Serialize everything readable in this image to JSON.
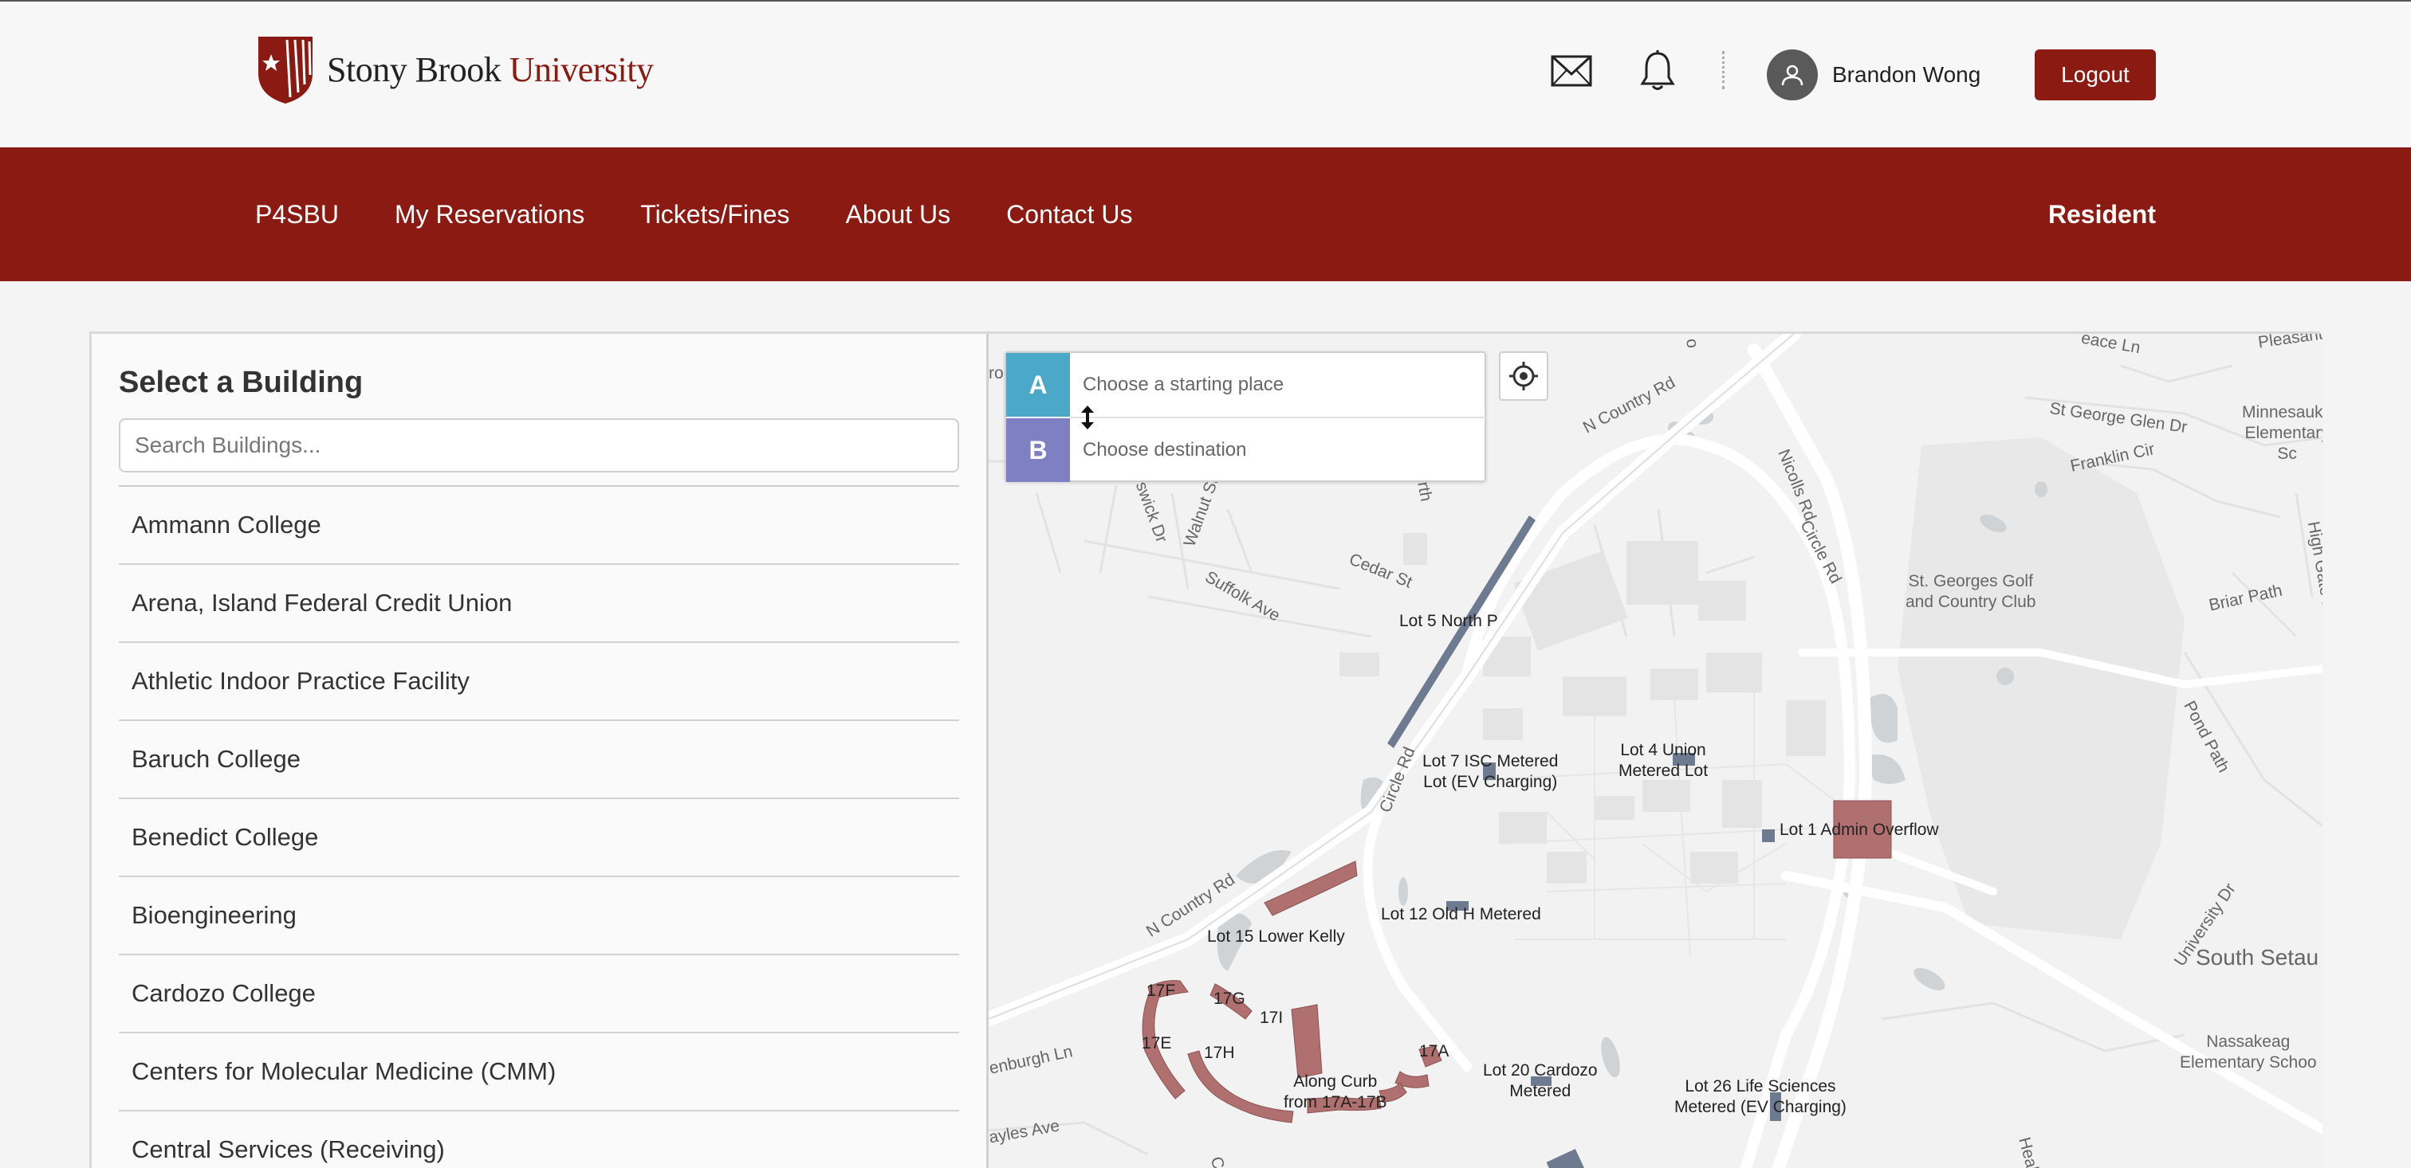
{
  "header": {
    "logo_word1": "Stony Brook",
    "logo_word2": "University",
    "mail_icon": "envelope-icon",
    "notifications_icon": "bell-icon",
    "user_name": "Brandon Wong",
    "logout_label": "Logout"
  },
  "nav": {
    "items": [
      {
        "label": "P4SBU"
      },
      {
        "label": "My Reservations"
      },
      {
        "label": "Tickets/Fines"
      },
      {
        "label": "About Us"
      },
      {
        "label": "Contact Us"
      }
    ],
    "role": "Resident"
  },
  "buildings": {
    "title": "Select a Building",
    "search_placeholder": "Search Buildings...",
    "items": [
      "Ammann College",
      "Arena, Island Federal Credit Union",
      "Athletic Indoor Practice Facility",
      "Baruch College",
      "Benedict College",
      "Bioengineering",
      "Cardozo College",
      "Centers for Molecular Medicine (CMM)",
      "Central Services (Receiving)"
    ]
  },
  "map": {
    "route": {
      "a_label": "A",
      "b_label": "B",
      "start_placeholder": "Choose a starting place",
      "destination_placeholder": "Choose destination"
    },
    "lots": {
      "lot5": "Lot 5 North P",
      "lot7_line1": "Lot 7 ISC Metered",
      "lot7_line2": "Lot (EV Charging)",
      "lot4_line1": "Lot 4 Union",
      "lot4_line2": "Metered Lot",
      "lot1": "Lot 1 Admin Overflow",
      "lot12": "Lot 12 Old H Metered",
      "lot15": "Lot 15 Lower Kelly",
      "l17f": "17F",
      "l17g": "17G",
      "l17i": "17I",
      "l17e": "17E",
      "l17h": "17H",
      "l17a": "17A",
      "curb_line1": "Along Curb",
      "curb_line2": "from 17A-17B",
      "lot20_line1": "Lot 20 Cardozo",
      "lot20_line2": "Metered",
      "lot26_line1": "Lot 26 Life Sciences",
      "lot26_line2": "Metered (EV Charging)"
    },
    "streets": {
      "n_country_rd_top": "N Country Rd",
      "n_country_rd_bottom": "N Country Rd",
      "nicolls_rd": "Nicolls Rd",
      "circle_rd_east": "Circle Rd",
      "circle_rd_west": "Circle Rd",
      "cedar_st": "Cedar St",
      "suffolk_ave": "Suffolk Ave",
      "walnut_st": "Walnut St",
      "brunswick_dr": "swick Dr",
      "st_george_glen": "St George Glen Dr",
      "franklin_cir": "Franklin Cir",
      "peace_ln": "eace Ln",
      "pleasant": "Pleasant",
      "briar_path": "Briar Path",
      "high_gate": "High Gate Dr",
      "pond_path": "Pond Path",
      "university_dr": "University Dr",
      "edinburgh_ln": "enburgh Ln",
      "sayles_ave": "ayles Ave",
      "health_s": "Health S",
      "cedar_bottom": "Ced",
      "north_top": "rth",
      "ro_left": "ro",
      "o_top": "o"
    },
    "places": {
      "minnesauke_line1": "Minnesauke",
      "minnesauke_line2": "Elementary Sc",
      "golf_line1": "St. Georges Golf",
      "golf_line2": "and Country Club",
      "south_setauket": "South Setau",
      "nassakeag_line1": "Nassakeag",
      "nassakeag_line2": "Elementary Schoo"
    },
    "colors": {
      "reserved_lot": "#b07070",
      "metered_lot": "#6e7a8f",
      "water": "#cfd3d6"
    }
  }
}
